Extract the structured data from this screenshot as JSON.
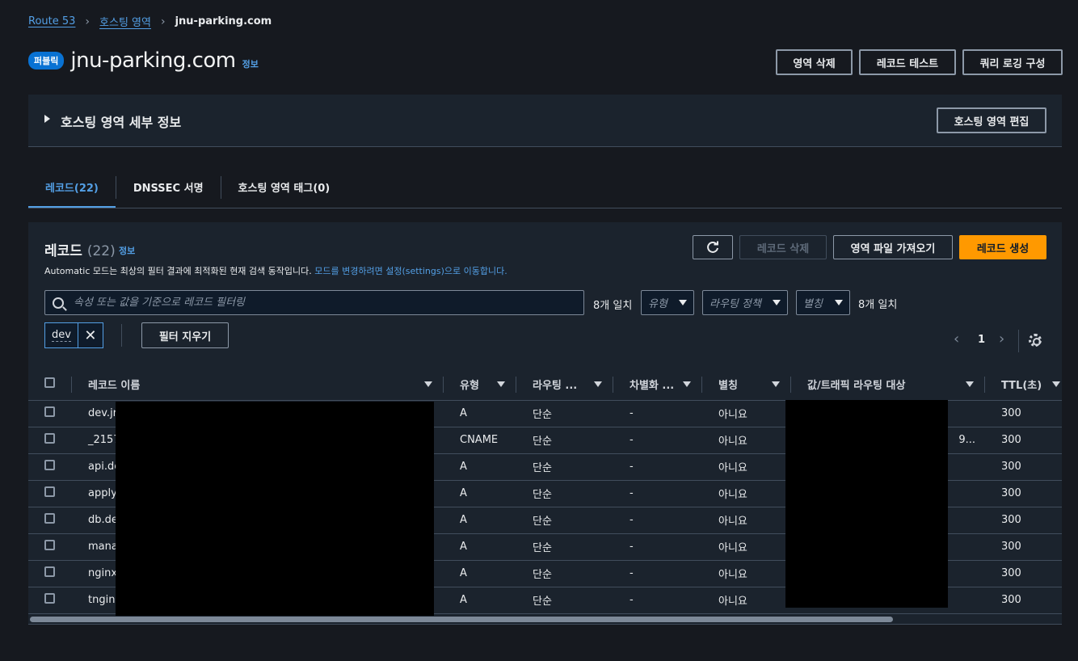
{
  "breadcrumb": {
    "items": [
      "Route 53",
      "호스팅 영역"
    ],
    "current": "jnu-parking.com"
  },
  "header": {
    "badge": "퍼블릭",
    "title": "jnu-parking.com",
    "info": "정보",
    "actions": {
      "delete_zone": "영역 삭제",
      "test_record": "레코드 테스트",
      "query_logging": "쿼리 로깅 구성"
    }
  },
  "details": {
    "title": "호스팅 영역 세부 정보",
    "edit": "호스팅 영역 편집"
  },
  "tabs": [
    {
      "label": "레코드(22)"
    },
    {
      "label": "DNSSEC 서명"
    },
    {
      "label": "호스팅 영역 태그(0)"
    }
  ],
  "records": {
    "title": "레코드",
    "count": "(22)",
    "info": "정보",
    "desc": "Automatic 모드는 최상의 필터 결과에 최적화된 현재 검색 동작입니다.",
    "desc_link": "모드를 변경하려면 설정(settings)으로 이동합니다.",
    "actions": {
      "delete": "레코드 삭제",
      "import": "영역 파일 가져오기",
      "create": "레코드 생성"
    },
    "search_placeholder": "속성 또는 값을 기준으로 레코드 필터링",
    "match_left": "8개 일치",
    "match_right": "8개 일치",
    "filters": {
      "type": "유형",
      "policy": "라우팅 정책",
      "alias": "별칭"
    },
    "token": "dev",
    "clear_filter": "필터 지우기",
    "page": "1",
    "columns": [
      "레코드 이름",
      "유형",
      "라우팅 ...",
      "차별화 ...",
      "별칭",
      "값/트래픽 라우팅 대상",
      "TTL(초)"
    ],
    "rows": [
      {
        "name": "dev.jr",
        "type": "A",
        "policy": "단순",
        "diff": "-",
        "alias": "아니요",
        "value": "",
        "ttl": "300"
      },
      {
        "name": "_2157",
        "type": "CNAME",
        "policy": "단순",
        "diff": "-",
        "alias": "아니요",
        "value": "9...",
        "ttl": "300"
      },
      {
        "name": "api.de",
        "type": "A",
        "policy": "단순",
        "diff": "-",
        "alias": "아니요",
        "value": "",
        "ttl": "300"
      },
      {
        "name": "apply",
        "type": "A",
        "policy": "단순",
        "diff": "-",
        "alias": "아니요",
        "value": "",
        "ttl": "300"
      },
      {
        "name": "db.de",
        "type": "A",
        "policy": "단순",
        "diff": "-",
        "alias": "아니요",
        "value": "",
        "ttl": "300"
      },
      {
        "name": "mana",
        "type": "A",
        "policy": "단순",
        "diff": "-",
        "alias": "아니요",
        "value": "",
        "ttl": "300"
      },
      {
        "name": "nginx",
        "type": "A",
        "policy": "단순",
        "diff": "-",
        "alias": "아니요",
        "value": "",
        "ttl": "300"
      },
      {
        "name": "tngin",
        "type": "A",
        "policy": "단순",
        "diff": "-",
        "alias": "아니요",
        "value": "",
        "ttl": "300"
      }
    ]
  },
  "colors": {
    "accent": "#539fe5",
    "primary": "#ff9900",
    "background": "#16191f"
  }
}
